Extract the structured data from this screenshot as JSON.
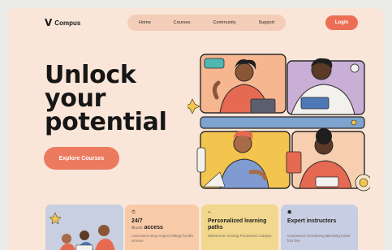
{
  "brand": {
    "logo_mark": "V",
    "name": "Compus"
  },
  "nav": {
    "items": [
      "Home",
      "Courses",
      "Community",
      "Support"
    ]
  },
  "header": {
    "login_label": "Login"
  },
  "hero": {
    "title_lines": [
      "Unlock",
      "your",
      "potential"
    ],
    "cta_label": "Explore Courses"
  },
  "features": [
    {
      "icon": "clock-icon",
      "title_number": "24/7",
      "title_prefix": "Acces",
      "title_suffix": "access",
      "text": "Lascosteon alng eroprec fottlegt fooullrs vmssce."
    },
    {
      "icon": "path-icon",
      "title": "Personalized learning paths",
      "text": "Wtbeterrorn oeramg Pocoteoelo codepse."
    },
    {
      "icon": "people-icon",
      "title": "Expert instructors",
      "text": "Coranestorn bcsetleeng latiessing tosser fnrs fore"
    }
  ],
  "colors": {
    "background": "#fae6d8",
    "accent": "#ec6f55",
    "nav_bg": "#f4cdb8"
  }
}
